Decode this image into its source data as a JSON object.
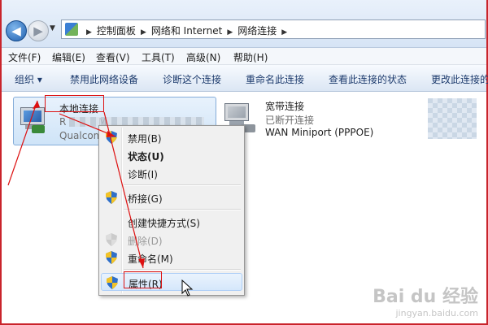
{
  "address_bar": {
    "breadcrumbs": [
      "控制面板",
      "网络和 Internet",
      "网络连接"
    ]
  },
  "menubar": {
    "items": [
      "文件(F)",
      "编辑(E)",
      "查看(V)",
      "工具(T)",
      "高级(N)",
      "帮助(H)"
    ]
  },
  "commandbar": {
    "items": [
      "组织 ▾",
      "禁用此网络设备",
      "诊断这个连接",
      "重命名此连接",
      "查看此连接的状态",
      "更改此连接的设"
    ]
  },
  "connections": [
    {
      "name": "本地连接",
      "status_partial": "R",
      "status_suffix": "M_",
      "adapter_partial": "Qualcom"
    },
    {
      "name": "宽带连接",
      "status": "已断开连接",
      "adapter": "WAN Miniport (PPPOE)"
    }
  ],
  "context_menu": {
    "items": [
      {
        "label": "禁用(B)",
        "shield": true,
        "bold": false,
        "disabled": false
      },
      {
        "label": "状态(U)",
        "shield": false,
        "bold": true,
        "disabled": false
      },
      {
        "label": "诊断(I)",
        "shield": false,
        "bold": false,
        "disabled": false
      },
      {
        "label": "桥接(G)",
        "shield": true,
        "bold": false,
        "disabled": false
      },
      {
        "label": "创建快捷方式(S)",
        "shield": false,
        "bold": false,
        "disabled": false
      },
      {
        "label": "删除(D)",
        "shield": true,
        "bold": false,
        "disabled": true
      },
      {
        "label": "重命名(M)",
        "shield": true,
        "bold": false,
        "disabled": false
      },
      {
        "label": "属性(R)",
        "shield": true,
        "bold": false,
        "disabled": false,
        "highlighted": true
      }
    ]
  },
  "watermark": {
    "main": "Bai du 经验",
    "sub": "jingyan.baidu.com"
  },
  "colors": {
    "annotation": "#dd1111",
    "accent": "#1f5fae"
  }
}
